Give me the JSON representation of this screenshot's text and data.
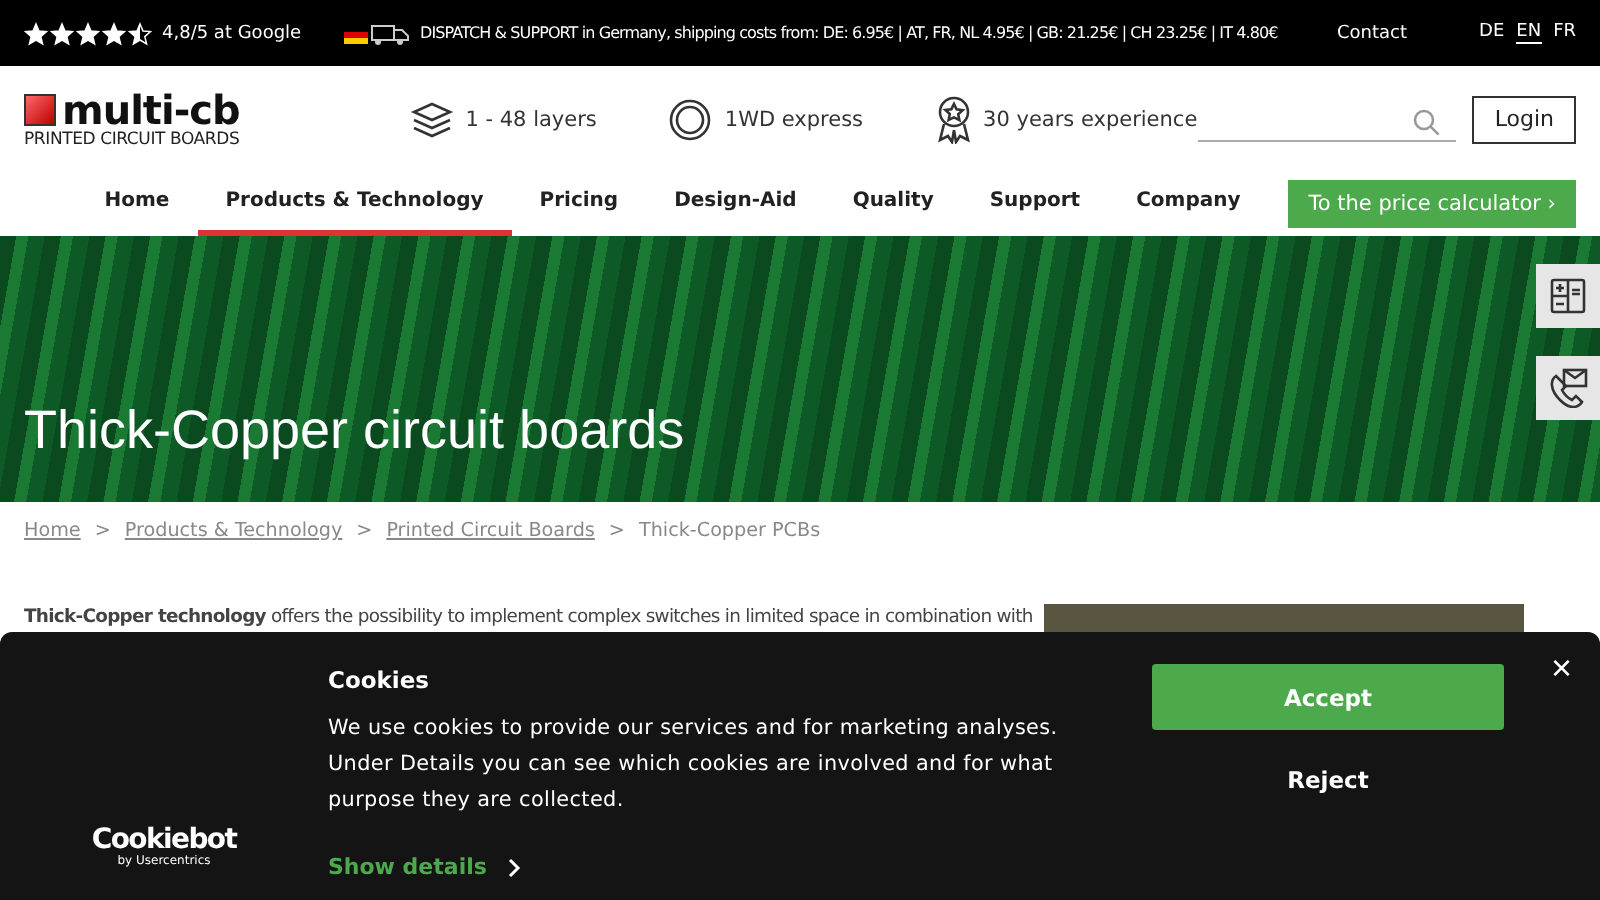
{
  "top_bar": {
    "rating": {
      "stars": 4.5,
      "text": "4,8/5 at Google"
    },
    "shipping": "DISPATCH & SUPPORT in Germany, shipping costs from: DE: 6.95€ | AT, FR, NL 4.95€ | GB: 21.25€ | CH 23.25€ | IT 4.80€",
    "contact": "Contact",
    "languages": [
      {
        "label": "DE",
        "selected": false
      },
      {
        "label": "EN",
        "selected": true
      },
      {
        "label": "FR",
        "selected": false
      }
    ]
  },
  "header": {
    "logo": {
      "name": "multi-cb",
      "tagline": "PRINTED CIRCUIT BOARDS"
    },
    "features": [
      {
        "kind": "layers",
        "label": "1 - 48 layers"
      },
      {
        "kind": "express",
        "label": "1WD express"
      },
      {
        "kind": "award",
        "label": "30 years experience"
      }
    ],
    "login": "Login"
  },
  "nav": {
    "items": [
      {
        "label": "Home",
        "selected": false
      },
      {
        "label": "Products & Technology",
        "selected": true
      },
      {
        "label": "Pricing",
        "selected": false
      },
      {
        "label": "Design-Aid",
        "selected": false
      },
      {
        "label": "Quality",
        "selected": false
      },
      {
        "label": "Support",
        "selected": false
      },
      {
        "label": "Company",
        "selected": false
      }
    ],
    "cta": "To the price calculator ›"
  },
  "hero": {
    "title": "Thick-Copper circuit boards"
  },
  "breadcrumb": [
    {
      "label": "Home",
      "link": true
    },
    {
      "label": "Products & Technology",
      "link": true
    },
    {
      "label": "Printed Circuit Boards",
      "link": true
    },
    {
      "label": "Thick-Copper PCBs",
      "link": false
    }
  ],
  "breadcrumb_separator": ">",
  "intro": "**Thick-Copper technology** offers the possibility to implement complex switches in limited space in combination with",
  "cookie_banner": {
    "brand": "Cookiebot",
    "brand_sub": "by Usercentrics",
    "title": "Cookies",
    "text": "We use cookies to provide our services and for marketing analyses. Under Details you can see which cookies are involved and for what purpose they are collected.",
    "details": "Show details",
    "accept": "Accept",
    "reject": "Reject",
    "close": "×"
  }
}
